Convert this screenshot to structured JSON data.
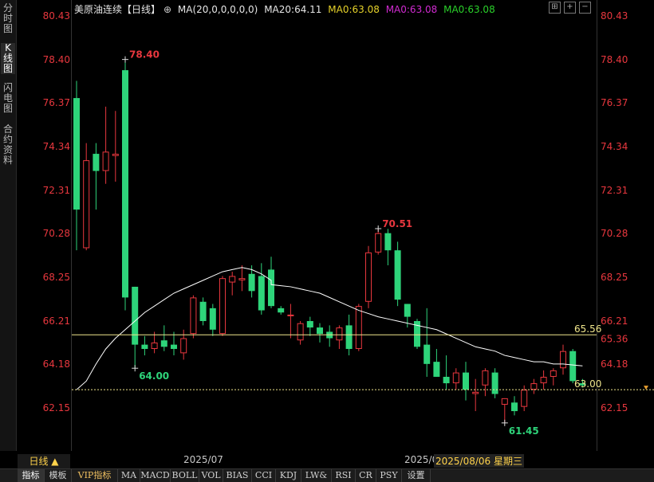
{
  "sidebar": {
    "tabs": [
      {
        "label": "分时图",
        "active": false
      },
      {
        "label": "K线图",
        "active": true
      },
      {
        "label": "闪电图",
        "active": false
      },
      {
        "label": "合约资料",
        "active": false
      }
    ]
  },
  "header": {
    "title": "美原油连续",
    "period_tag": "【日线】",
    "ma_spec": "MA(20,0,0,0,0,0)",
    "ma20": "MA20:64.11",
    "ma_a": "MA0:63.08",
    "ma_b": "MA0:63.08",
    "ma_c": "MA0:63.08",
    "colors": {
      "title": "#e6e6e6",
      "ma20": "#e6e6e6",
      "ma_a": "#e6d22a",
      "ma_b": "#d12ad1",
      "ma_c": "#2ad12a"
    }
  },
  "y_axis_labels": [
    "80.43",
    "78.40",
    "76.37",
    "74.34",
    "72.31",
    "70.28",
    "68.25",
    "66.21",
    "64.18",
    "62.15"
  ],
  "x_axis": {
    "label1": "2025/07",
    "label2": "2025/0",
    "cursor_date": "2025/08/06 星期三"
  },
  "period_button": "日线 ▲",
  "bottom_tabs": [
    "指标",
    "模板",
    "VIP指标",
    "MA",
    "MACD",
    "BOLL",
    "VOL",
    "BIAS",
    "CCI",
    "KDJ",
    "LW&",
    "RSI",
    "CR",
    "PSY",
    "设置"
  ],
  "chart_data": {
    "type": "candlestick",
    "y_range": [
      61.0,
      80.43
    ],
    "up_color": "#e8373e",
    "down_color": "#2ed47a",
    "ma_color": "#ffffff",
    "annotations": {
      "high1": "78.40",
      "low1": "64.00",
      "high2": "70.51",
      "low2": "61.45"
    },
    "hlines": [
      {
        "value": 65.56,
        "label": "65.56",
        "color": "#f0e68c"
      },
      {
        "value": 63.0,
        "label": "63.00",
        "color": "#f0e68c"
      }
    ],
    "current_price": "65.36",
    "candles": [
      {
        "o": 76.6,
        "h": 77.4,
        "l": 69.5,
        "c": 71.4
      },
      {
        "o": 69.6,
        "h": 74.5,
        "l": 69.5,
        "c": 73.7
      },
      {
        "o": 74.0,
        "h": 74.5,
        "l": 71.4,
        "c": 73.2
      },
      {
        "o": 73.2,
        "h": 76.2,
        "l": 72.6,
        "c": 74.1
      },
      {
        "o": 73.9,
        "h": 76.0,
        "l": 72.7,
        "c": 74.0
      },
      {
        "o": 77.9,
        "h": 78.4,
        "l": 66.7,
        "c": 67.3
      },
      {
        "o": 67.8,
        "h": 67.8,
        "l": 64.0,
        "c": 65.1
      },
      {
        "o": 65.1,
        "h": 65.5,
        "l": 64.6,
        "c": 64.9
      },
      {
        "o": 64.9,
        "h": 65.7,
        "l": 64.7,
        "c": 65.2
      },
      {
        "o": 65.3,
        "h": 66.0,
        "l": 64.8,
        "c": 65.0
      },
      {
        "o": 65.1,
        "h": 65.7,
        "l": 64.6,
        "c": 64.9
      },
      {
        "o": 64.7,
        "h": 65.8,
        "l": 64.4,
        "c": 65.4
      },
      {
        "o": 65.6,
        "h": 67.4,
        "l": 65.4,
        "c": 67.3
      },
      {
        "o": 67.1,
        "h": 67.3,
        "l": 66.0,
        "c": 66.2
      },
      {
        "o": 66.8,
        "h": 67.0,
        "l": 65.5,
        "c": 65.8
      },
      {
        "o": 65.6,
        "h": 68.3,
        "l": 65.5,
        "c": 68.2
      },
      {
        "o": 68.0,
        "h": 68.5,
        "l": 67.4,
        "c": 68.3
      },
      {
        "o": 68.1,
        "h": 68.8,
        "l": 67.6,
        "c": 68.2
      },
      {
        "o": 68.4,
        "h": 68.8,
        "l": 67.3,
        "c": 67.6
      },
      {
        "o": 68.3,
        "h": 68.9,
        "l": 66.5,
        "c": 66.7
      },
      {
        "o": 68.6,
        "h": 69.2,
        "l": 66.8,
        "c": 66.9
      },
      {
        "o": 66.8,
        "h": 66.9,
        "l": 66.5,
        "c": 66.6
      },
      {
        "o": 66.5,
        "h": 67.0,
        "l": 65.4,
        "c": 66.5
      },
      {
        "o": 65.3,
        "h": 66.2,
        "l": 65.1,
        "c": 66.1
      },
      {
        "o": 66.2,
        "h": 66.4,
        "l": 65.5,
        "c": 65.9
      },
      {
        "o": 65.9,
        "h": 66.1,
        "l": 65.2,
        "c": 65.6
      },
      {
        "o": 65.7,
        "h": 66.0,
        "l": 65.0,
        "c": 65.4
      },
      {
        "o": 65.3,
        "h": 66.0,
        "l": 64.9,
        "c": 65.9
      },
      {
        "o": 66.0,
        "h": 66.5,
        "l": 64.6,
        "c": 64.9
      },
      {
        "o": 64.9,
        "h": 67.0,
        "l": 64.8,
        "c": 66.9
      },
      {
        "o": 67.1,
        "h": 69.7,
        "l": 66.8,
        "c": 69.4
      },
      {
        "o": 69.4,
        "h": 70.5,
        "l": 69.3,
        "c": 70.3
      },
      {
        "o": 70.3,
        "h": 70.5,
        "l": 68.8,
        "c": 69.5
      },
      {
        "o": 69.5,
        "h": 69.9,
        "l": 66.9,
        "c": 67.2
      },
      {
        "o": 67.0,
        "h": 67.0,
        "l": 65.9,
        "c": 66.4
      },
      {
        "o": 66.2,
        "h": 66.3,
        "l": 64.9,
        "c": 65.0
      },
      {
        "o": 65.1,
        "h": 66.8,
        "l": 63.6,
        "c": 64.2
      },
      {
        "o": 64.3,
        "h": 64.9,
        "l": 63.6,
        "c": 63.6
      },
      {
        "o": 63.6,
        "h": 64.6,
        "l": 63.0,
        "c": 63.3
      },
      {
        "o": 63.3,
        "h": 64.0,
        "l": 63.0,
        "c": 63.8
      },
      {
        "o": 63.8,
        "h": 64.3,
        "l": 62.5,
        "c": 63.0
      },
      {
        "o": 62.8,
        "h": 63.5,
        "l": 62.0,
        "c": 62.9
      },
      {
        "o": 63.2,
        "h": 64.0,
        "l": 62.7,
        "c": 63.9
      },
      {
        "o": 63.8,
        "h": 64.0,
        "l": 62.6,
        "c": 62.8
      },
      {
        "o": 62.3,
        "h": 62.6,
        "l": 61.45,
        "c": 62.6
      },
      {
        "o": 62.4,
        "h": 62.7,
        "l": 61.8,
        "c": 62.0
      },
      {
        "o": 62.2,
        "h": 63.2,
        "l": 62.0,
        "c": 63.0
      },
      {
        "o": 63.0,
        "h": 63.5,
        "l": 62.8,
        "c": 63.3
      },
      {
        "o": 63.3,
        "h": 63.9,
        "l": 63.0,
        "c": 63.6
      },
      {
        "o": 63.6,
        "h": 64.0,
        "l": 63.2,
        "c": 63.9
      },
      {
        "o": 64.0,
        "h": 65.1,
        "l": 63.7,
        "c": 64.8
      },
      {
        "o": 64.8,
        "h": 64.9,
        "l": 63.3,
        "c": 63.4
      },
      {
        "o": 63.3,
        "h": 63.5,
        "l": 63.1,
        "c": 63.2
      }
    ],
    "ma20": [
      null,
      null,
      null,
      null,
      null,
      null,
      null,
      null,
      null,
      null,
      null,
      null,
      null,
      null,
      null,
      null,
      null,
      null,
      null,
      null,
      67.9,
      67.85,
      67.8,
      67.7,
      67.6,
      67.5,
      67.3,
      67.1,
      66.9,
      66.7,
      66.55,
      66.4,
      66.3,
      66.2,
      66.1,
      66.0,
      65.9,
      65.8,
      65.6,
      65.4,
      65.2,
      65.0,
      64.9,
      64.8,
      64.6,
      64.5,
      64.4,
      64.3,
      64.3,
      64.2,
      64.2,
      64.15,
      64.11
    ]
  }
}
